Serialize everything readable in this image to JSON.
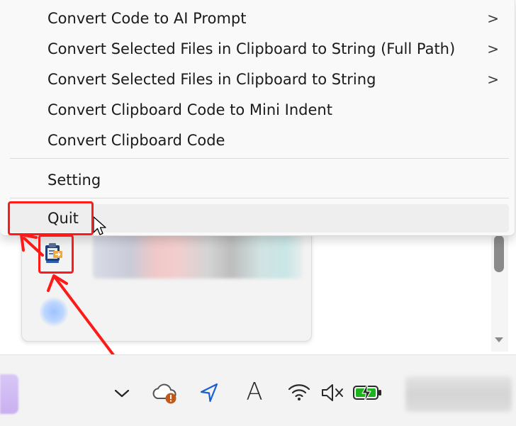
{
  "menu": {
    "items": [
      {
        "label": "Convert Code to AI Prompt",
        "has_submenu": true
      },
      {
        "label": "Convert Selected Files in Clipboard to String (Full Path)",
        "has_submenu": true
      },
      {
        "label": "Convert Selected Files in Clipboard to String",
        "has_submenu": true
      },
      {
        "label": "Convert Clipboard Code to Mini Indent",
        "has_submenu": false
      },
      {
        "label": "Convert Clipboard Code",
        "has_submenu": false
      },
      {
        "label": "Setting",
        "has_submenu": false
      },
      {
        "label": "Quit",
        "has_submenu": false,
        "hovered": true
      }
    ],
    "submenu_glyph": ">"
  },
  "tray": {
    "icons": [
      "chevron-up-icon",
      "onedrive-warning-icon",
      "location-icon",
      "ime-icon",
      "wifi-icon",
      "volume-muted-icon",
      "battery-charging-icon"
    ],
    "ime_label": "A",
    "overflow_app_icon": "clipboard-app-icon"
  },
  "colors": {
    "annotation": "#ff1a1a",
    "battery_fill": "#1db31d",
    "location": "#1a5fd1",
    "warning_badge": "#c0591a"
  }
}
